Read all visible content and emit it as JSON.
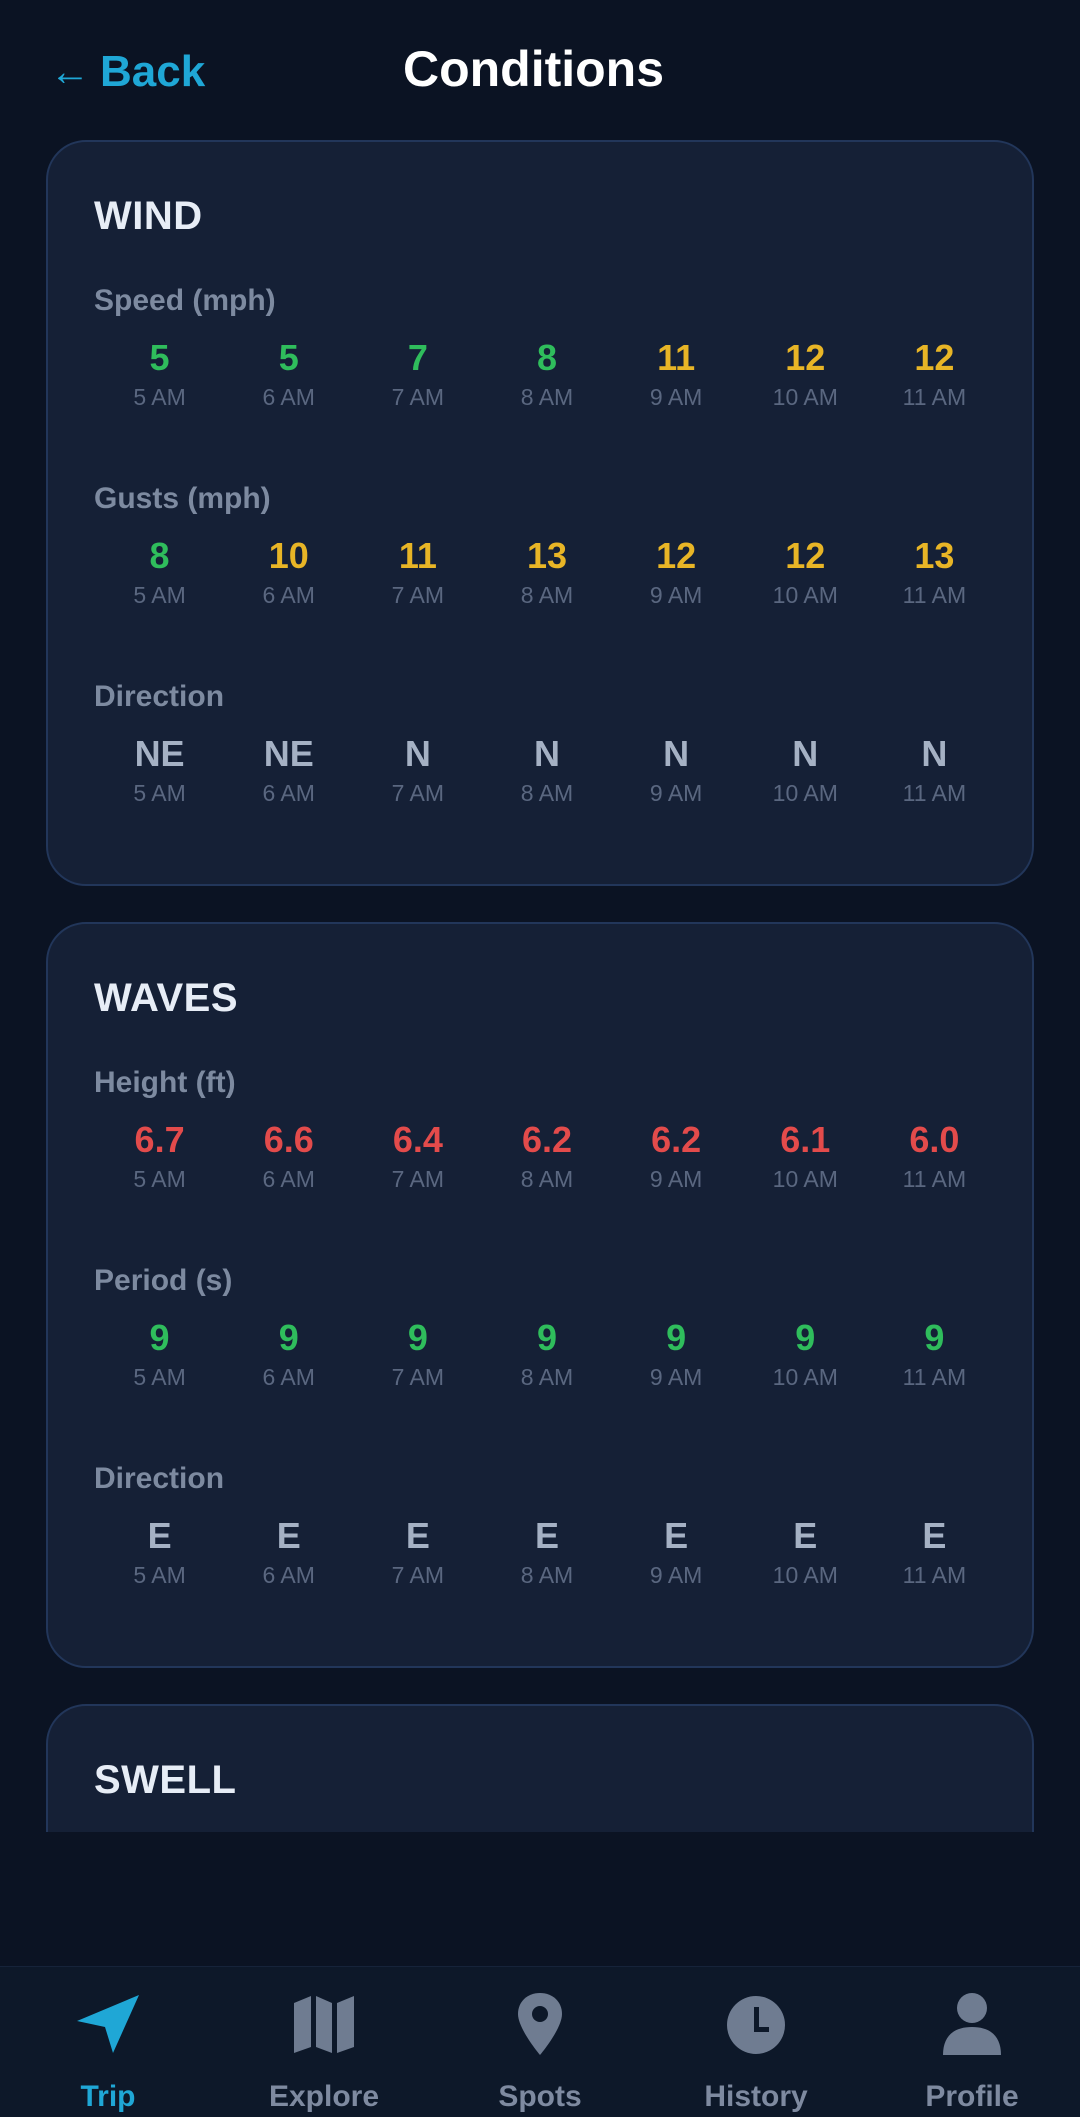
{
  "header": {
    "back_arrow": "←",
    "back_label": "Back",
    "title": "Conditions"
  },
  "hours": [
    "5 AM",
    "6 AM",
    "7 AM",
    "8 AM",
    "9 AM",
    "10 AM",
    "11 AM"
  ],
  "colors": {
    "green": "#2fbd5c",
    "yellow": "#e8b526",
    "red": "#e34b4b",
    "neutral": "#a5b1c4",
    "accent": "#1fa7d6"
  },
  "cards": [
    {
      "title": "WIND",
      "metrics": [
        {
          "label": "Speed (mph)",
          "values": [
            {
              "v": "5",
              "c": "green"
            },
            {
              "v": "5",
              "c": "green"
            },
            {
              "v": "7",
              "c": "green"
            },
            {
              "v": "8",
              "c": "green"
            },
            {
              "v": "11",
              "c": "yellow"
            },
            {
              "v": "12",
              "c": "yellow"
            },
            {
              "v": "12",
              "c": "yellow"
            }
          ]
        },
        {
          "label": "Gusts (mph)",
          "values": [
            {
              "v": "8",
              "c": "green"
            },
            {
              "v": "10",
              "c": "yellow"
            },
            {
              "v": "11",
              "c": "yellow"
            },
            {
              "v": "13",
              "c": "yellow"
            },
            {
              "v": "12",
              "c": "yellow"
            },
            {
              "v": "12",
              "c": "yellow"
            },
            {
              "v": "13",
              "c": "yellow"
            }
          ]
        },
        {
          "label": "Direction",
          "values": [
            {
              "v": "NE",
              "c": "neutral"
            },
            {
              "v": "NE",
              "c": "neutral"
            },
            {
              "v": "N",
              "c": "neutral"
            },
            {
              "v": "N",
              "c": "neutral"
            },
            {
              "v": "N",
              "c": "neutral"
            },
            {
              "v": "N",
              "c": "neutral"
            },
            {
              "v": "N",
              "c": "neutral"
            }
          ]
        }
      ]
    },
    {
      "title": "WAVES",
      "metrics": [
        {
          "label": "Height (ft)",
          "values": [
            {
              "v": "6.7",
              "c": "red"
            },
            {
              "v": "6.6",
              "c": "red"
            },
            {
              "v": "6.4",
              "c": "red"
            },
            {
              "v": "6.2",
              "c": "red"
            },
            {
              "v": "6.2",
              "c": "red"
            },
            {
              "v": "6.1",
              "c": "red"
            },
            {
              "v": "6.0",
              "c": "red"
            }
          ]
        },
        {
          "label": "Period (s)",
          "values": [
            {
              "v": "9",
              "c": "green"
            },
            {
              "v": "9",
              "c": "green"
            },
            {
              "v": "9",
              "c": "green"
            },
            {
              "v": "9",
              "c": "green"
            },
            {
              "v": "9",
              "c": "green"
            },
            {
              "v": "9",
              "c": "green"
            },
            {
              "v": "9",
              "c": "green"
            }
          ]
        },
        {
          "label": "Direction",
          "values": [
            {
              "v": "E",
              "c": "neutral"
            },
            {
              "v": "E",
              "c": "neutral"
            },
            {
              "v": "E",
              "c": "neutral"
            },
            {
              "v": "E",
              "c": "neutral"
            },
            {
              "v": "E",
              "c": "neutral"
            },
            {
              "v": "E",
              "c": "neutral"
            },
            {
              "v": "E",
              "c": "neutral"
            }
          ]
        }
      ]
    },
    {
      "title": "SWELL",
      "metrics": []
    }
  ],
  "nav": [
    {
      "label": "Trip",
      "icon": "navigation-arrow-icon",
      "active": true
    },
    {
      "label": "Explore",
      "icon": "map-icon",
      "active": false
    },
    {
      "label": "Spots",
      "icon": "map-pin-icon",
      "active": false
    },
    {
      "label": "History",
      "icon": "clock-icon",
      "active": false
    },
    {
      "label": "Profile",
      "icon": "user-icon",
      "active": false
    }
  ]
}
